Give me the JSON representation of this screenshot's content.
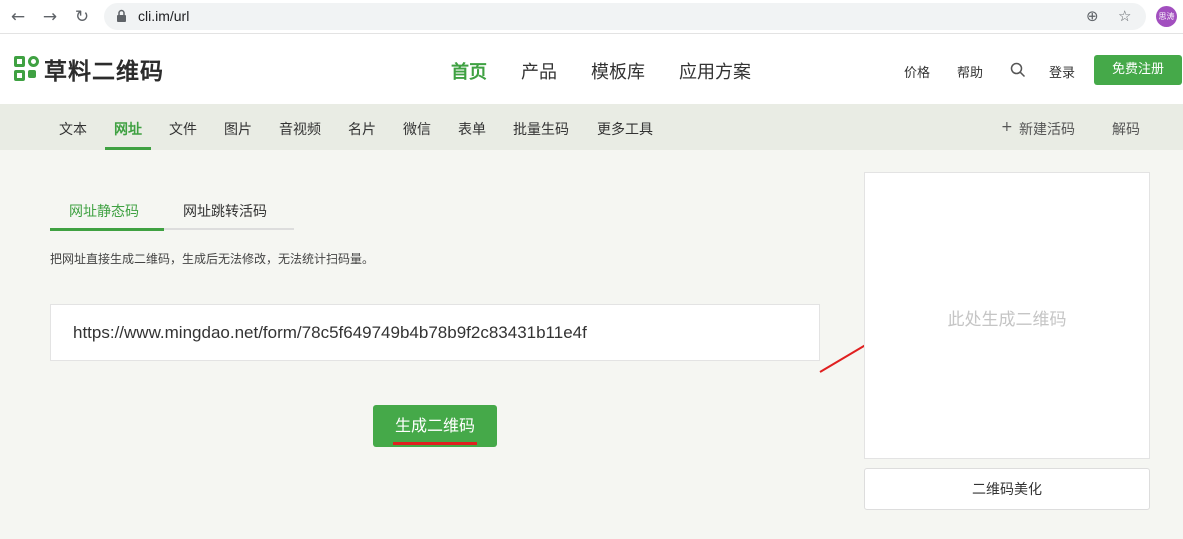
{
  "browser": {
    "url": "cli.im/url",
    "avatar_text": "思涛"
  },
  "header": {
    "logo_text": "草料二维码",
    "nav": [
      "首页",
      "产品",
      "模板库",
      "应用方案"
    ],
    "price": "价格",
    "help": "帮助",
    "login": "登录",
    "register": "免费注册"
  },
  "subnav": {
    "items": [
      "文本",
      "网址",
      "文件",
      "图片",
      "音视频",
      "名片",
      "微信",
      "表单",
      "批量生码",
      "更多工具"
    ],
    "new_dynamic": "新建活码",
    "decode": "解码"
  },
  "tabs": [
    "网址静态码",
    "网址跳转活码"
  ],
  "description": "把网址直接生成二维码，生成后无法修改，无法统计扫码量。",
  "input_value": "https://www.mingdao.net/form/78c5f649749b4b78b9f2c83431b11e4f",
  "generate_button": "生成二维码",
  "qr_placeholder": "此处生成二维码",
  "beautify_button": "二维码美化",
  "colors": {
    "brand_green": "#3fa142",
    "button_green": "#45a949",
    "annotation_red": "#e02020"
  }
}
